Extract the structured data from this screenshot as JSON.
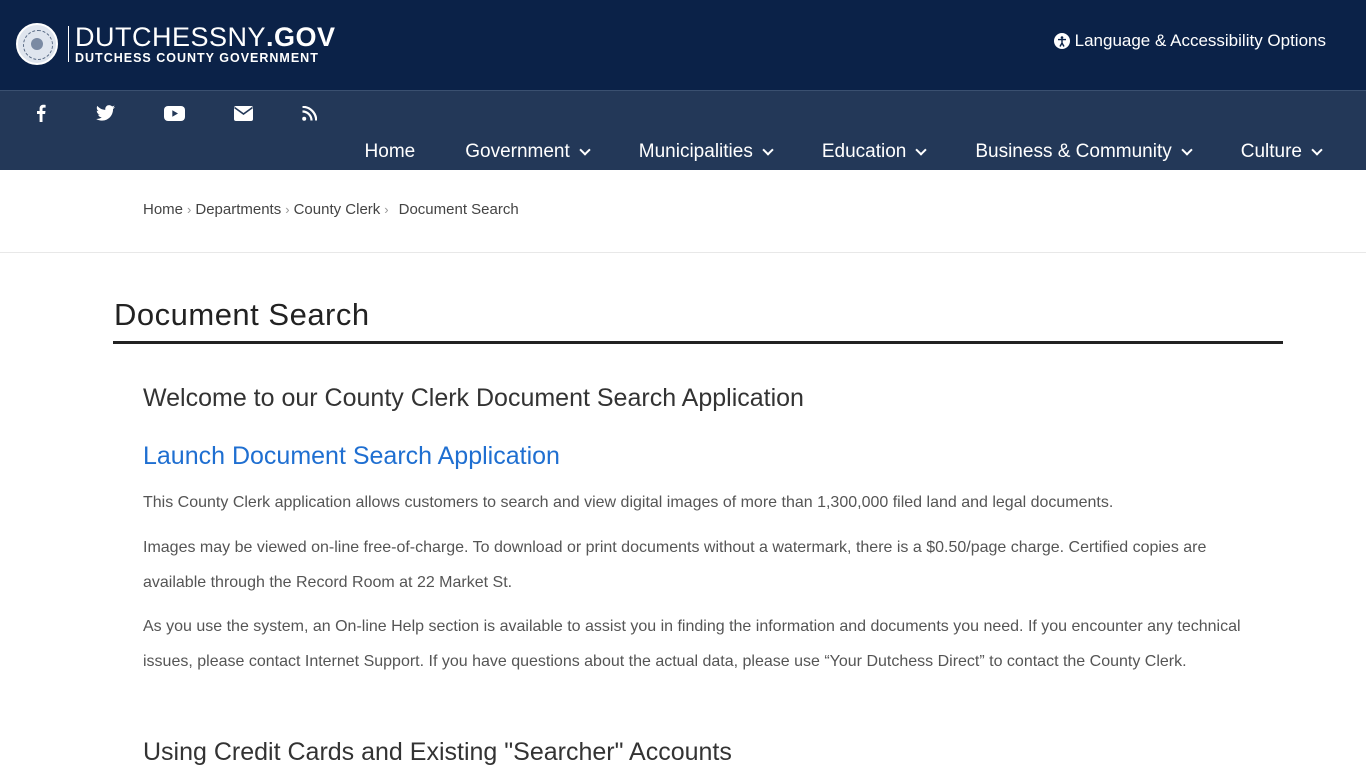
{
  "header": {
    "site_name_main": "DUTCHESSNY",
    "site_name_tld": ".GOV",
    "site_subtitle": "DUTCHESS COUNTY GOVERNMENT",
    "language_link": "Language & Accessibility Options",
    "colors": {
      "top_bar": "#0b2248",
      "nav_bar": "#233858",
      "link": "#1f6fd1"
    }
  },
  "social": [
    {
      "icon": "facebook-icon"
    },
    {
      "icon": "twitter-icon"
    },
    {
      "icon": "youtube-icon"
    },
    {
      "icon": "email-icon"
    },
    {
      "icon": "rss-icon"
    }
  ],
  "nav": {
    "items": [
      {
        "label": "Home",
        "dropdown": false
      },
      {
        "label": "Government",
        "dropdown": true
      },
      {
        "label": "Municipalities",
        "dropdown": true
      },
      {
        "label": "Education",
        "dropdown": true
      },
      {
        "label": "Business & Community",
        "dropdown": true
      },
      {
        "label": "Culture",
        "dropdown": true
      }
    ]
  },
  "breadcrumb": {
    "items": [
      "Home",
      "Departments",
      "County Clerk"
    ],
    "current": "Document Search"
  },
  "page": {
    "title": "Document Search",
    "welcome_heading": "Welcome to our County Clerk Document Search Application",
    "launch_link": "Launch Document Search Application",
    "paragraphs": [
      "This County Clerk application allows customers to search and view digital images of more than 1,300,000 filed land and legal documents.",
      "Images may be viewed on-line free-of-charge. To download or print documents without a watermark, there is a $0.50/page charge. Certified copies are available through the Record Room at 22 Market St.",
      "As you use the system, an On-line Help section is available to assist you in finding the information and documents you need. If you encounter any technical issues, please contact Internet Support. If you have questions about the actual data, please use “Your Dutchess Direct” to contact the County Clerk."
    ],
    "credit_heading": "Using Credit Cards and Existing \"Searcher\" Accounts"
  }
}
